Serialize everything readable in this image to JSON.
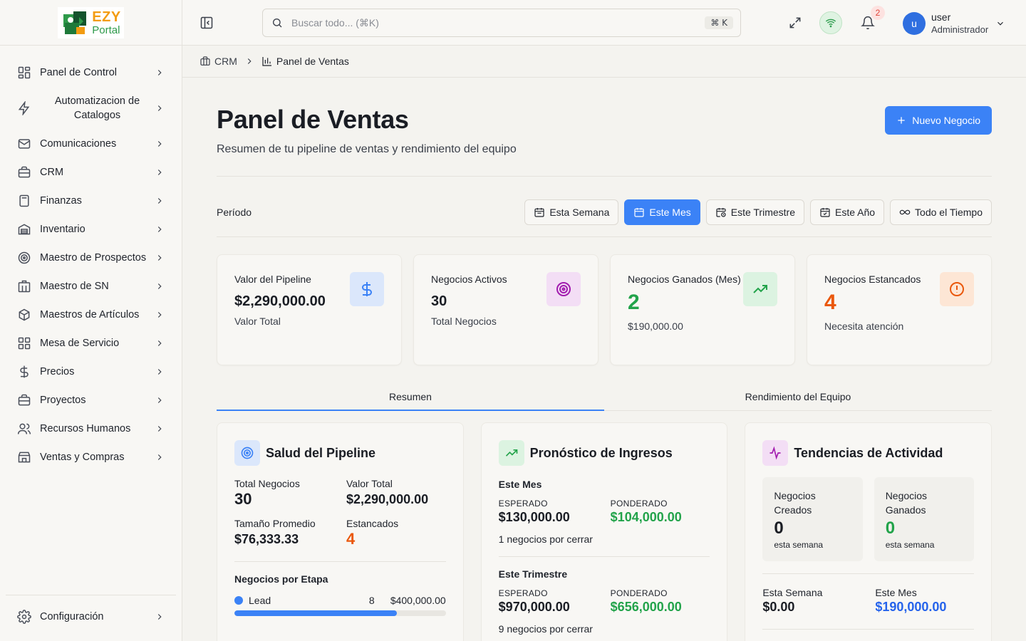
{
  "logo": {
    "line1": "EZY",
    "line2": "Portal"
  },
  "sidebar": {
    "items": [
      {
        "label": "Panel de Control",
        "icon": "dashboard-icon"
      },
      {
        "label": "Automatizacion de Catalogos",
        "icon": "bolt-icon"
      },
      {
        "label": "Comunicaciones",
        "icon": "mail-icon"
      },
      {
        "label": "CRM",
        "icon": "briefcase-icon"
      },
      {
        "label": "Finanzas",
        "icon": "calculator-icon"
      },
      {
        "label": "Inventario",
        "icon": "warehouse-icon"
      },
      {
        "label": "Maestro de Prospectos",
        "icon": "target-icon"
      },
      {
        "label": "Maestro de SN",
        "icon": "building-icon"
      },
      {
        "label": "Maestros de Artículos",
        "icon": "box-icon"
      },
      {
        "label": "Mesa de Servicio",
        "icon": "grid-icon"
      },
      {
        "label": "Precios",
        "icon": "dollar-icon"
      },
      {
        "label": "Proyectos",
        "icon": "briefcase-icon"
      },
      {
        "label": "Recursos Humanos",
        "icon": "users-icon"
      },
      {
        "label": "Ventas y Compras",
        "icon": "store-icon"
      }
    ],
    "settings": {
      "label": "Configuración",
      "icon": "gear-icon"
    }
  },
  "topbar": {
    "search_placeholder": "Buscar todo... (⌘K)",
    "shortcut": "⌘ K",
    "notifications_count": "2",
    "user": {
      "initial": "u",
      "name": "user",
      "role": "Administrador"
    }
  },
  "breadcrumb": {
    "parent": "CRM",
    "current": "Panel de Ventas"
  },
  "header": {
    "title": "Panel de Ventas",
    "subtitle": "Resumen de tu pipeline de ventas y rendimiento del equipo",
    "new_button": "Nuevo Negocio"
  },
  "period": {
    "label": "Período",
    "options": [
      "Esta Semana",
      "Este Mes",
      "Este Trimestre",
      "Este Año",
      "Todo el Tiempo"
    ],
    "selected": "Este Mes"
  },
  "kpis": [
    {
      "title": "Valor del Pipeline",
      "value": "$2,290,000.00",
      "sub": "Valor Total",
      "icon": "dollar-icon",
      "color": "#3b82f6"
    },
    {
      "title": "Negocios Activos",
      "value": "30",
      "sub": "Total Negocios",
      "icon": "target-icon",
      "color": "#a21caf"
    },
    {
      "title": "Negocios Ganados (Mes)",
      "value": "2",
      "sub": "$190,000.00",
      "icon": "trending-up-icon",
      "color": "#22a34a"
    },
    {
      "title": "Negocios Estancados",
      "value": "4",
      "sub": "Necesita atención",
      "icon": "alert-circle-icon",
      "color": "#ea580c"
    }
  ],
  "tabs": [
    "Resumen",
    "Rendimiento del Equipo"
  ],
  "pipeline_health": {
    "title": "Salud del Pipeline",
    "total_deals_label": "Total Negocios",
    "total_deals": "30",
    "total_value_label": "Valor Total",
    "total_value": "$2,290,000.00",
    "avg_size_label": "Tamaño Promedio",
    "avg_size": "$76,333.33",
    "stalled_label": "Estancados",
    "stalled": "4",
    "by_stage_title": "Negocios por Etapa",
    "stages": [
      {
        "name": "Lead",
        "count": "8",
        "value": "$400,000.00",
        "fill": 0.77
      }
    ]
  },
  "forecast": {
    "title": "Pronóstico de Ingresos",
    "periods": [
      {
        "title": "Este Mes",
        "expected_label": "ESPERADO",
        "expected": "$130,000.00",
        "weighted_label": "PONDERADO",
        "weighted": "$104,000.00",
        "note": "1 negocios por cerrar"
      },
      {
        "title": "Este Trimestre",
        "expected_label": "ESPERADO",
        "expected": "$970,000.00",
        "weighted_label": "PONDERADO",
        "weighted": "$656,000.00",
        "note": "9 negocios por cerrar"
      }
    ]
  },
  "activity": {
    "title": "Tendencias de Actividad",
    "created_label": "Negocios Creados",
    "created": "0",
    "created_period": "esta semana",
    "won_label": "Negocios Ganados",
    "won": "0",
    "won_period": "esta semana",
    "week_label": "Esta Semana",
    "week_value": "$0.00",
    "month_label": "Este Mes",
    "month_value": "$190,000.00"
  }
}
